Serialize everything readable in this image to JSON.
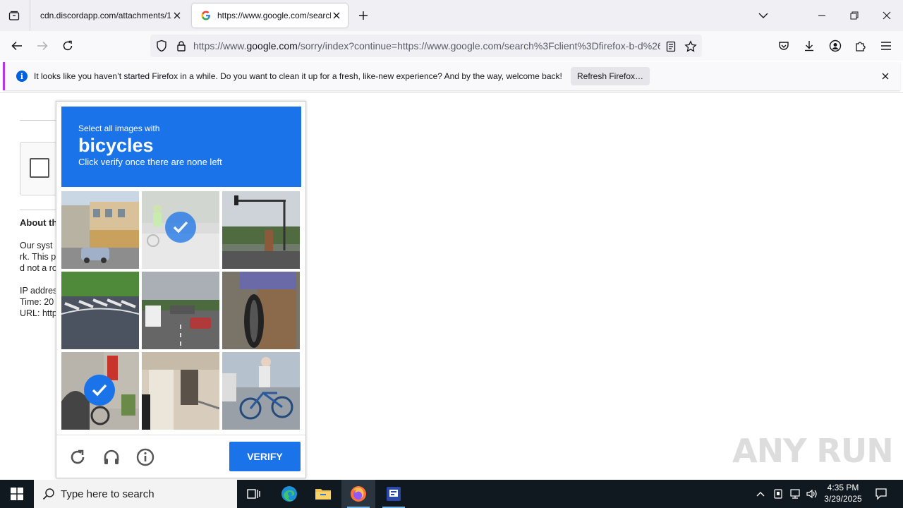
{
  "browser": {
    "tabs": [
      {
        "title": "cdn.discordapp.com/attachments/1",
        "active": false
      },
      {
        "title": "https://www.google.com/search",
        "active": true
      }
    ],
    "url_domain_prefix": "https://www.",
    "url_domain": "google.com",
    "url_rest": "/sorry/index?continue=https://www.google.com/search%3Fclient%3Dfirefox-b-d%26"
  },
  "notification": {
    "message": "It looks like you haven’t started Firefox in a while. Do you want to clean it up for a fresh, like-new experience? And by the way, welcome back!",
    "button": "Refresh Firefox…"
  },
  "background_page": {
    "about_title": "About th",
    "para1_line1": "Our syst",
    "para1_line2": "rk. This p",
    "para1_line3": "d not a ro",
    "ip_label": "IP addres",
    "time_label": "Time: 20",
    "url_label": "URL: http"
  },
  "captcha": {
    "instruction_small": "Select all images with",
    "target": "bicycles",
    "instruction_sub": "Click verify once there are none left",
    "verify_label": "VERIFY",
    "tiles": [
      {
        "name": "tile-storefront-street",
        "selected": false
      },
      {
        "name": "tile-cyclist",
        "selected": true
      },
      {
        "name": "tile-traffic-light",
        "selected": false
      },
      {
        "name": "tile-road-crosswalk",
        "selected": false
      },
      {
        "name": "tile-highway-trucks",
        "selected": false
      },
      {
        "name": "tile-bike-wheel-closeup",
        "selected": false
      },
      {
        "name": "tile-parked-bikes",
        "selected": true
      },
      {
        "name": "tile-building-entrance",
        "selected": false
      },
      {
        "name": "tile-person-on-bicycle",
        "selected": false
      }
    ]
  },
  "watermark": "ANY RUN",
  "taskbar": {
    "search_placeholder": "Type here to search",
    "time": "4:35 PM",
    "date": "3/29/2025"
  }
}
